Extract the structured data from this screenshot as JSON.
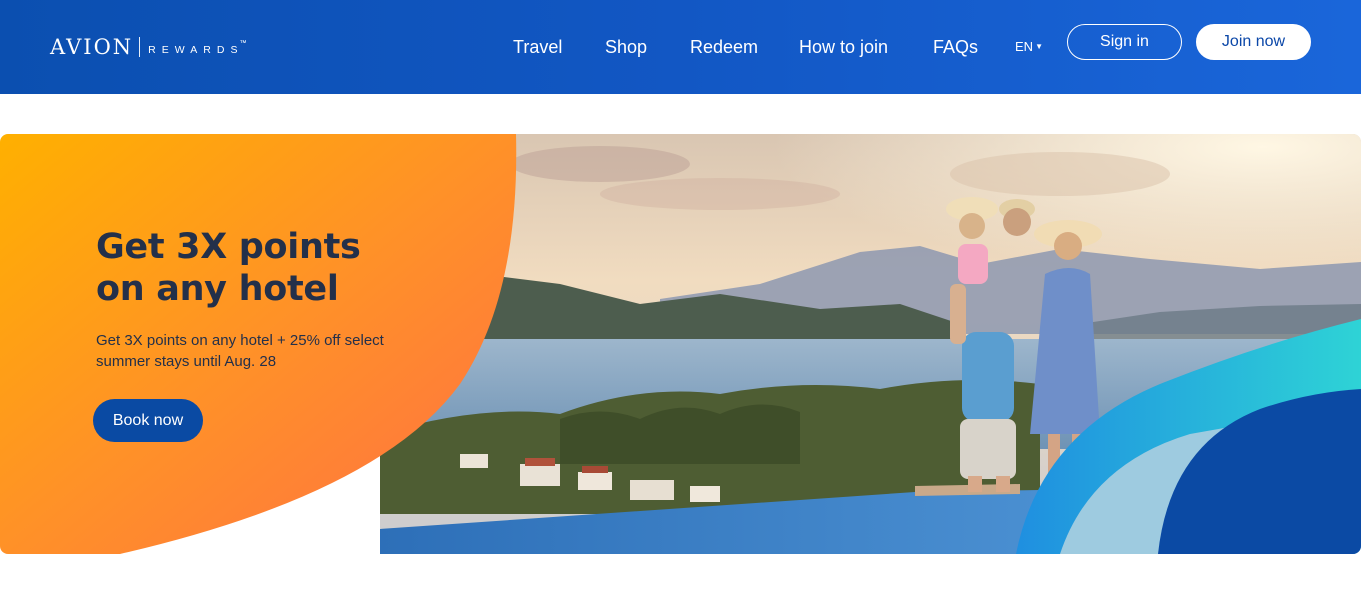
{
  "brand": {
    "name": "AVION",
    "subname": "REWARDS",
    "tm": "™"
  },
  "nav": {
    "items": [
      {
        "label": "Travel"
      },
      {
        "label": "Shop"
      },
      {
        "label": "Redeem"
      },
      {
        "label": "How to join"
      },
      {
        "label": "FAQs"
      }
    ],
    "language": "EN",
    "language_caret": "▼",
    "signin_label": "Sign in",
    "join_label": "Join now"
  },
  "hero": {
    "title": "Get 3X points on any hotel",
    "subtitle": "Get 3X points on any hotel + 25% off select summer stays until Aug. 28",
    "cta_label": "Book now",
    "image_semantic": "family-overlooking-bay-photo"
  },
  "colors": {
    "header_blue": "#1257c4",
    "orange_start": "#ffb000",
    "orange_end": "#ff7a3a",
    "title_text": "#23304a",
    "cta_blue": "#0a4aa3",
    "accent_teal": "#2fc7d6"
  }
}
